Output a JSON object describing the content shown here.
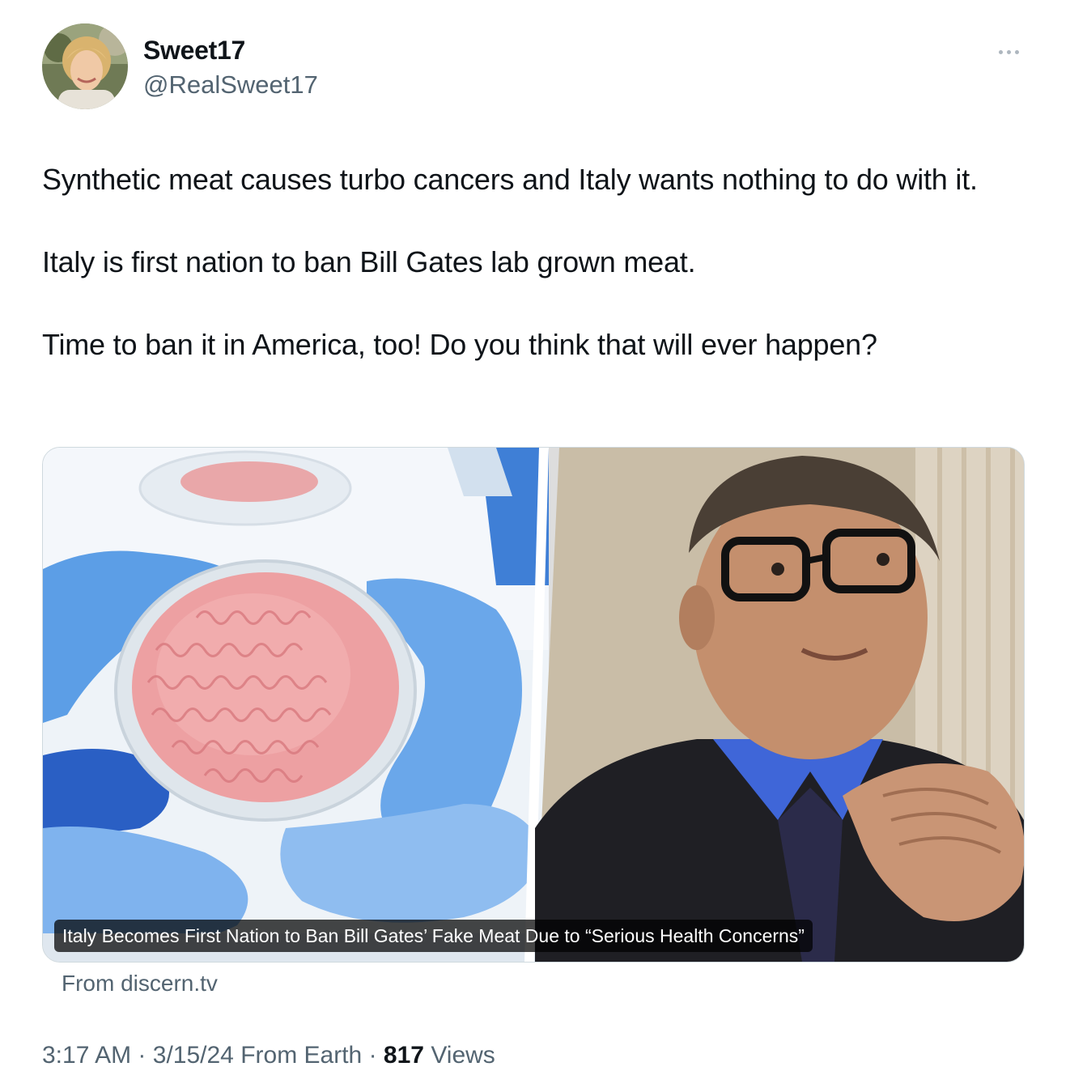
{
  "author": {
    "display_name": "Sweet17",
    "handle": "@RealSweet17",
    "avatar_icon": "avatar-photo"
  },
  "more_icon": "more-horizontal-icon",
  "tweet": {
    "paragraphs": [
      "Synthetic meat causes turbo cancers and Italy wants nothing to do with it.",
      "Italy is first nation to ban Bill Gates lab grown meat.",
      "Time to ban it in America, too! Do you think that will ever happen?"
    ]
  },
  "link_card": {
    "caption": "Italy Becomes First Nation to Ban Bill Gates’ Fake Meat Due to “Serious Health Concerns”",
    "source": "From discern.tv",
    "left_image": "gloved-hands-holding-petri-dish-of-lab-grown-meat",
    "right_image": "portrait-of-man-in-glasses-with-clasped-hands"
  },
  "meta": {
    "time": "3:17 AM",
    "separator": "·",
    "date": "3/15/24",
    "location": "From Earth",
    "views_count": "817",
    "views_label": "Views"
  },
  "colors": {
    "text_primary": "#0f1419",
    "text_secondary": "#536471",
    "border": "#cfd9de"
  }
}
